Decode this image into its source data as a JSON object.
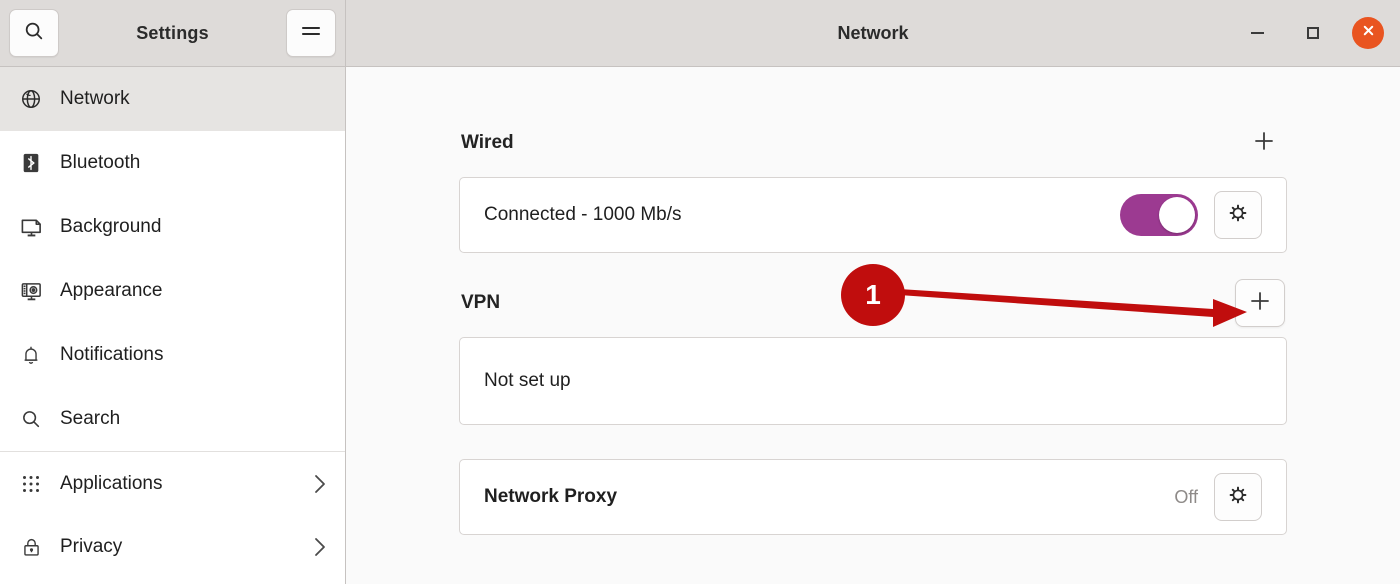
{
  "titlebar": {
    "app_title": "Settings",
    "window_title": "Network",
    "search_icon": "search-icon",
    "menu_icon": "hamburger-menu-icon",
    "minimize_icon": "minimize-icon",
    "maximize_icon": "maximize-icon",
    "close_icon": "close-icon",
    "close_color": "#e95420"
  },
  "sidebar": {
    "items": [
      {
        "label": "Network",
        "icon": "globe-icon",
        "selected": true,
        "chevron": false,
        "group_top": false
      },
      {
        "label": "Bluetooth",
        "icon": "bluetooth-icon",
        "selected": false,
        "chevron": false,
        "group_top": false
      },
      {
        "label": "Background",
        "icon": "monitor-icon",
        "selected": false,
        "chevron": false,
        "group_top": false
      },
      {
        "label": "Appearance",
        "icon": "appearance-icon",
        "selected": false,
        "chevron": false,
        "group_top": false
      },
      {
        "label": "Notifications",
        "icon": "bell-icon",
        "selected": false,
        "chevron": false,
        "group_top": false
      },
      {
        "label": "Search",
        "icon": "search-icon",
        "selected": false,
        "chevron": false,
        "group_top": false
      },
      {
        "label": "Applications",
        "icon": "grid-dots-icon",
        "selected": false,
        "chevron": true,
        "group_top": true
      },
      {
        "label": "Privacy",
        "icon": "lock-icon",
        "selected": false,
        "chevron": true,
        "group_top": false
      }
    ]
  },
  "content": {
    "wired": {
      "title": "Wired",
      "add_icon": "plus-icon",
      "status": "Connected - 1000 Mb/s",
      "toggle_state": "on",
      "toggle_color": "#9c3a91",
      "settings_icon": "gear-icon"
    },
    "vpn": {
      "title": "VPN",
      "add_icon": "plus-icon",
      "status": "Not set up"
    },
    "proxy": {
      "title": "Network Proxy",
      "state": "Off",
      "settings_icon": "gear-icon"
    }
  },
  "annotation": {
    "step_number": "1",
    "color": "#c00d0d",
    "arrow_icon": "arrow-right-icon"
  }
}
